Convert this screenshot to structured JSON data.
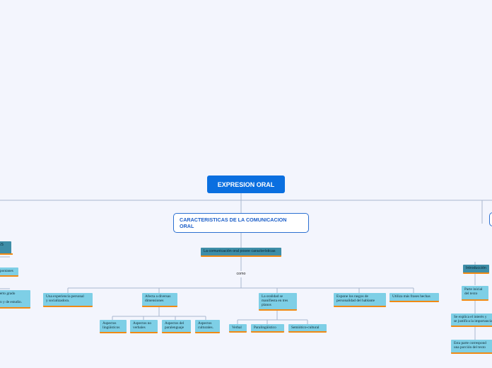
{
  "root": "EXPRESION ORAL",
  "main_node": "CARACTERISTICAS DE LA COMUNICACION\nORAL",
  "sub_node": "La comunicación oral posee características",
  "connector": "como",
  "features": [
    "Una experiencia personal\ny socializadora.",
    "Afecta a diversas\ndimensiones",
    "La oralidad se\nmanifiesta en  tres\nplanos",
    "Expone los rasgos de\npersonalidad del hablante",
    "Utiliza más frases hechas"
  ],
  "dimensions": [
    "Aspectos\nlingüísticos",
    "Aspectos no\nverbales",
    "Aspectos del\nparalenguaje",
    "Aspectos\nculturales."
  ],
  "planes": [
    "Verbal",
    "Paralingüístico",
    "Semiótico-cultural"
  ],
  "left_partial": [
    "NES\nL.",
    "pontanes",
    "cierto grado\n\nión y de estudio."
  ],
  "right_partial": [
    "Introducción",
    "Parte inicial\ndel texto",
    "Se explica el interés  y\nse justifica la importancia",
    "Esta parte correspond\nuna porción del texto"
  ]
}
